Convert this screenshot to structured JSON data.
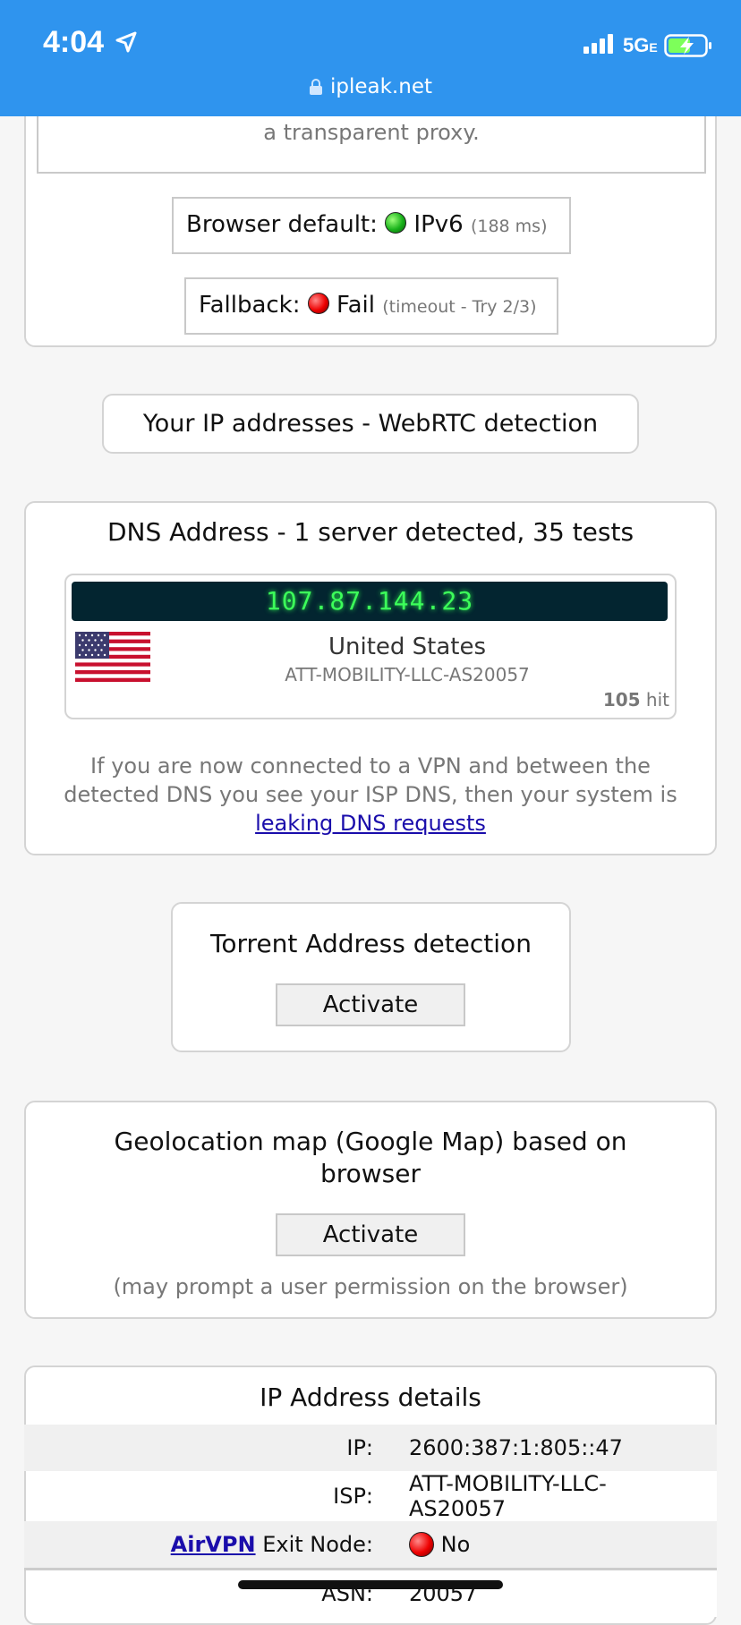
{
  "status_bar": {
    "time": "4:04",
    "network": "5G",
    "network_suffix": "E",
    "url": "ipleak.net"
  },
  "top_card": {
    "proxy_text": "a transparent proxy.",
    "browser_default_label": "Browser default:",
    "browser_default_value": "IPv6",
    "browser_default_detail": "(188 ms)",
    "browser_default_status_color": "#18b21a",
    "fallback_label": "Fallback:",
    "fallback_value": "Fail",
    "fallback_detail": "(timeout - Try 2/3)",
    "fallback_status_color": "#e00000"
  },
  "webrtc_button_label": "Your IP addresses - WebRTC detection",
  "dns": {
    "title": "DNS Address - 1 server detected, 35 tests",
    "ip": "107.87.144.23",
    "country": "United States",
    "isp": "ATT-MOBILITY-LLC-AS20057",
    "hits_count": "105",
    "hits_label": "hit",
    "note_text": "If you are now connected to a VPN and between the detected DNS you see your ISP DNS, then your system is",
    "note_link": "leaking DNS requests"
  },
  "torrent": {
    "title": "Torrent Address detection",
    "button_label": "Activate"
  },
  "geolocation": {
    "title": "Geolocation map (Google Map) based on browser",
    "button_label": "Activate",
    "note": "(may prompt a user permission on the browser)"
  },
  "ip_details": {
    "title": "IP Address details",
    "rows": [
      {
        "key": "IP:",
        "value": "2600:387:1:805::47"
      },
      {
        "key": "ISP:",
        "value": "ATT-MOBILITY-LLC-AS20057"
      },
      {
        "key_link": "AirVPN",
        "key": "Exit Node:",
        "value": "No"
      },
      {
        "key": "ASN:",
        "value": "20057"
      }
    ]
  }
}
